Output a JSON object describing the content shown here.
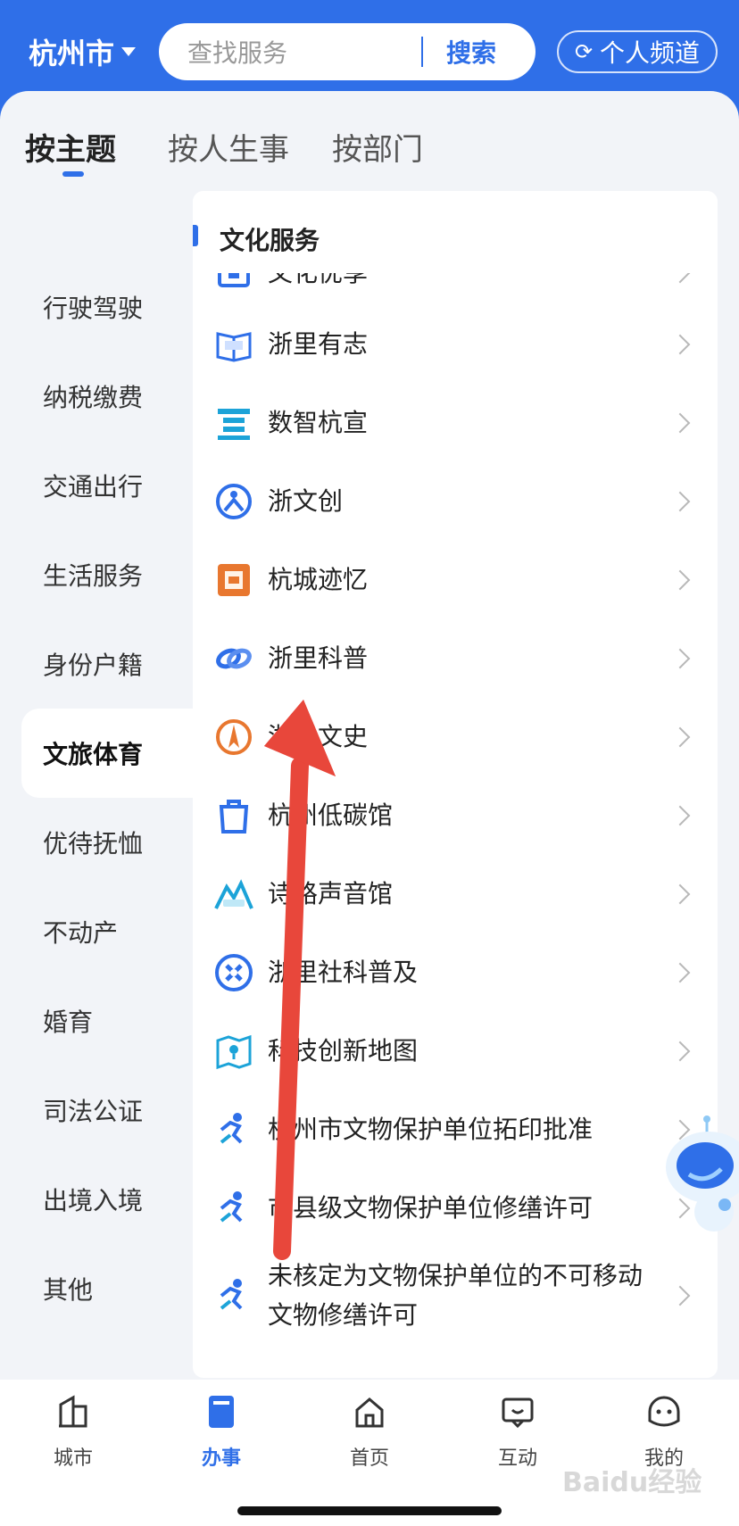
{
  "header": {
    "city": "杭州市",
    "search_placeholder": "查找服务",
    "search_button": "搜索",
    "channel_button": "个人频道"
  },
  "tabs": [
    {
      "label": "按主题",
      "active": true
    },
    {
      "label": "按人生事",
      "active": false
    },
    {
      "label": "按部门",
      "active": false
    }
  ],
  "sidebar": {
    "items": [
      {
        "label": "行驶驾驶"
      },
      {
        "label": "纳税缴费"
      },
      {
        "label": "交通出行"
      },
      {
        "label": "生活服务"
      },
      {
        "label": "身份户籍"
      },
      {
        "label": "文旅体育",
        "active": true
      },
      {
        "label": "优待抚恤"
      },
      {
        "label": "不动产"
      },
      {
        "label": "婚育"
      },
      {
        "label": "司法公证"
      },
      {
        "label": "出境入境"
      },
      {
        "label": "其他"
      }
    ]
  },
  "panel": {
    "title": "文化服务",
    "items": [
      {
        "label": "文化优享",
        "icon": "library-icon",
        "color": "#2f6fe8"
      },
      {
        "label": "浙里有志",
        "icon": "book-icon",
        "color": "#2f6fe8"
      },
      {
        "label": "数智杭宣",
        "icon": "xuan-icon",
        "color": "#1ca3d8"
      },
      {
        "label": "浙文创",
        "icon": "person-circle-icon",
        "color": "#2f6fe8"
      },
      {
        "label": "杭城迹忆",
        "icon": "memory-icon",
        "color": "#e8772f"
      },
      {
        "label": "浙里科普",
        "icon": "link-logo-icon",
        "color": "#2f6fe8"
      },
      {
        "label": "浙里文史",
        "icon": "compass-icon",
        "color": "#e8772f"
      },
      {
        "label": "杭州低碳馆",
        "icon": "bag-icon",
        "color": "#2f6fe8"
      },
      {
        "label": "诗路声音馆",
        "icon": "mountain-icon",
        "color": "#1ca3d8"
      },
      {
        "label": "浙里社科普及",
        "icon": "atom-icon",
        "color": "#2f6fe8"
      },
      {
        "label": "科技创新地图",
        "icon": "map-pin-icon",
        "color": "#1ca3d8"
      },
      {
        "label": "杭州市文物保护单位拓印批准",
        "icon": "runner-icon",
        "color": "#2f6fe8"
      },
      {
        "label": "市县级文物保护单位修缮许可",
        "icon": "runner-icon",
        "color": "#2f6fe8"
      },
      {
        "label": "未核定为文物保护单位的不可移动文物修缮许可",
        "icon": "runner-icon",
        "color": "#2f6fe8"
      }
    ]
  },
  "bottom_nav": [
    {
      "label": "城市",
      "icon": "city-icon"
    },
    {
      "label": "办事",
      "icon": "book-fill-icon",
      "active": true
    },
    {
      "label": "首页",
      "icon": "home-icon"
    },
    {
      "label": "互动",
      "icon": "chat-icon"
    },
    {
      "label": "我的",
      "icon": "face-icon"
    }
  ],
  "colors": {
    "brand_blue": "#2f6fe8",
    "annotation_arrow": "#e8473b"
  },
  "watermark": "Baidu经验"
}
